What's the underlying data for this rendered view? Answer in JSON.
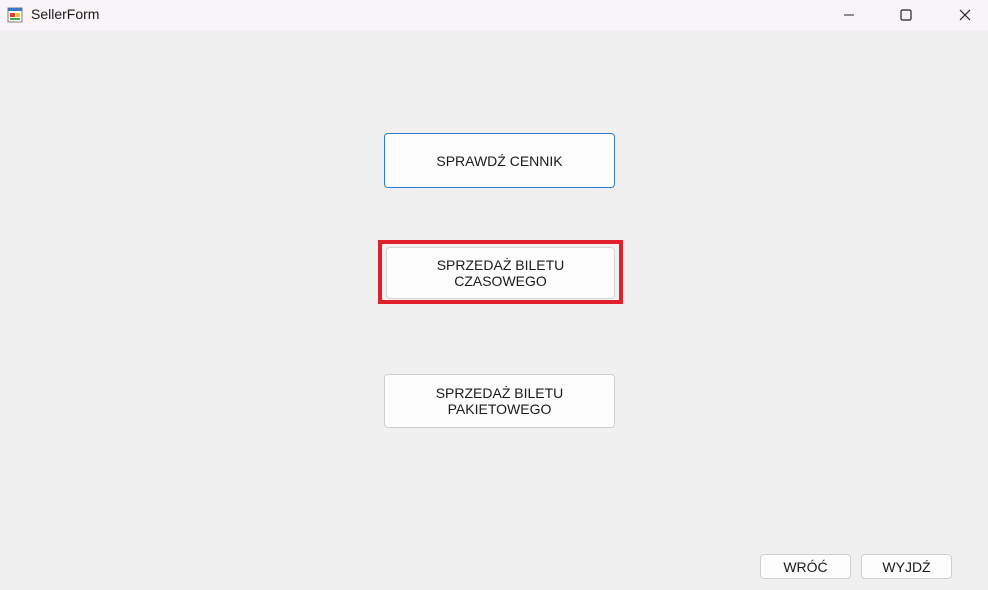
{
  "window": {
    "title": "SellerForm",
    "icon": "app-form-icon"
  },
  "buttons": {
    "check_prices": "SPRAWDŹ CENNIK",
    "sell_time_ticket": "SPRZEDAŻ BILETU CZASOWEGO",
    "sell_package_ticket": "SPRZEDAŻ BILETU PAKIETOWEGO",
    "back": "WRÓĆ",
    "exit": "WYJDŹ"
  },
  "colors": {
    "highlight": "#e0202a",
    "focus_border": "#2a7fd4",
    "background": "#f0f0f0"
  }
}
